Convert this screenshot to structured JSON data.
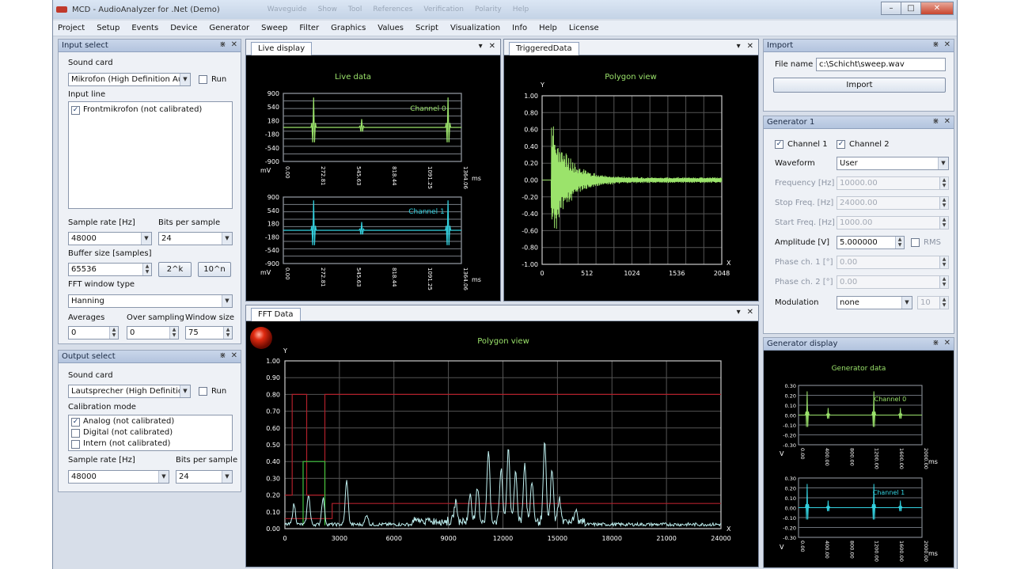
{
  "window": {
    "title": "MCD - AudioAnalyzer for .Net (Demo)",
    "ghost_items": [
      "Waveguide",
      "Show",
      "Tool",
      "References",
      "Verification",
      "Polarity",
      "Help"
    ]
  },
  "menu": [
    "Project",
    "Setup",
    "Events",
    "Device",
    "Generator",
    "Sweep",
    "Filter",
    "Graphics",
    "Values",
    "Script",
    "Visualization",
    "Info",
    "Help",
    "License"
  ],
  "input_select": {
    "title": "Input select",
    "sound_card_label": "Sound card",
    "sound_card_value": "Mikrofon (High Definition Aud",
    "run_label": "Run",
    "input_line_label": "Input line",
    "input_line_item": "Frontmikrofon (not calibrated)",
    "sample_rate_label": "Sample rate [Hz]",
    "sample_rate_value": "48000",
    "bits_label": "Bits per sample",
    "bits_value": "24",
    "buffer_label": "Buffer size [samples]",
    "buffer_value": "65536",
    "btn_2k": "2^k",
    "btn_10n": "10^n",
    "fft_label": "FFT window type",
    "fft_value": "Hanning",
    "averages_label": "Averages",
    "averages_value": "0",
    "oversampling_label": "Over sampling",
    "oversampling_value": "0",
    "window_label": "Window size",
    "window_value": "75"
  },
  "output_select": {
    "title": "Output select",
    "sound_card_label": "Sound card",
    "sound_card_value": "Lautsprecher (High Definition",
    "run_label": "Run",
    "calibration_label": "Calibration mode",
    "calibration_items": [
      "Analog (not calibrated)",
      "Digital (not calibrated)",
      "Intern (not calibrated)"
    ],
    "calibration_checked": [
      true,
      false,
      false
    ],
    "sample_rate_label": "Sample rate [Hz]",
    "sample_rate_value": "48000",
    "bits_label": "Bits per sample",
    "bits_value": "24"
  },
  "live_display": {
    "tab": "Live display",
    "title": "Live data",
    "unit_y": "mV",
    "unit_x": "ms",
    "yticks": [
      "900",
      "540",
      "180",
      "-180",
      "-540",
      "-900"
    ],
    "xticks": [
      "0.00",
      "272.81",
      "545.63",
      "818.44",
      "1091.25",
      "1364.06"
    ],
    "channels": [
      "Channel 0",
      "Channel 1"
    ]
  },
  "triggered": {
    "tab": "TriggeredData",
    "title": "Polygon view",
    "axis_y": "Y",
    "axis_x": "X",
    "yticks": [
      "1.00",
      "0.80",
      "0.60",
      "0.40",
      "0.20",
      "0.00",
      "-0.20",
      "-0.40",
      "-0.60",
      "-0.80",
      "-1.00"
    ],
    "xticks": [
      "0",
      "512",
      "1024",
      "1536",
      "2048"
    ]
  },
  "fft": {
    "tab": "FFT Data",
    "title": "Polygon view",
    "axis_y": "Y",
    "axis_x": "X",
    "yticks": [
      "1.00",
      "0.90",
      "0.80",
      "0.70",
      "0.60",
      "0.50",
      "0.40",
      "0.30",
      "0.20",
      "0.10",
      "0.00"
    ],
    "xticks": [
      "0",
      "3000",
      "6000",
      "9000",
      "12000",
      "15000",
      "18000",
      "21000",
      "24000"
    ]
  },
  "import": {
    "title": "Import",
    "file_label": "File name",
    "file_value": "c:\\Schicht\\sweep.wav",
    "button": "Import"
  },
  "generator": {
    "title": "Generator 1",
    "channel0": "Channel 1",
    "channel1": "Channel 2",
    "waveform_label": "Waveform",
    "waveform_value": "User",
    "frequency_label": "Frequency [Hz]",
    "frequency_value": "10000.00",
    "stop_freq_label": "Stop Freq. [Hz]",
    "stop_freq_value": "24000.00",
    "start_freq_label": "Start Freq. [Hz]",
    "start_freq_value": "1000.00",
    "amplitude_label": "Amplitude [V]",
    "amplitude_value": "5.000000",
    "rms_label": "RMS",
    "phase1_label": "Phase ch. 1 [°]",
    "phase1_value": "0.00",
    "phase2_label": "Phase ch. 2 [°]",
    "phase2_value": "0.00",
    "modulation_label": "Modulation",
    "modulation_value": "none",
    "modulation_num": "10"
  },
  "generator_display": {
    "title": "Generator display",
    "plot_title": "Generator data",
    "unit_y": "V",
    "unit_x": "ms",
    "channels": [
      "Channel 0",
      "Channel 1"
    ],
    "yticks": [
      "0.30",
      "0.20",
      "0.10",
      "0.00",
      "-0.10",
      "-0.20",
      "-0.30"
    ],
    "xticks": [
      "0.00",
      "400.00",
      "800.00",
      "1200.00",
      "1600.00",
      "2000.00"
    ]
  },
  "colors": {
    "green": "#9be36b",
    "cyan": "#33d2e0",
    "red": "#8b1a1a",
    "lightcyan": "#bff0f0"
  }
}
